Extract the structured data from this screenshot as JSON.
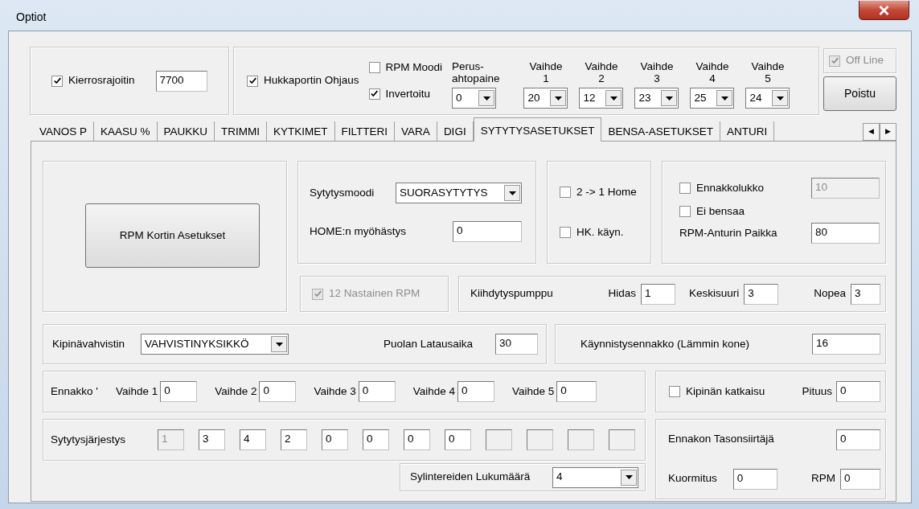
{
  "window": {
    "title": "Optiot"
  },
  "top": {
    "rev_limiter": {
      "label": "Kierrosrajoitin",
      "checked": true,
      "value": "7700"
    },
    "wastegate": {
      "label": "Hukkaportin Ohjaus",
      "checked": true
    },
    "rpm_mode": {
      "label": "RPM Moodi",
      "checked": false
    },
    "inverted": {
      "label": "Invertoitu",
      "checked": true
    },
    "combos": [
      {
        "label_lines": [
          "Perus-",
          "ahtopaine"
        ],
        "value": "0"
      },
      {
        "label_lines": [
          "Vaihde",
          "1"
        ],
        "value": "20"
      },
      {
        "label_lines": [
          "Vaihde",
          "2"
        ],
        "value": "12"
      },
      {
        "label_lines": [
          "Vaihde",
          "3"
        ],
        "value": "23"
      },
      {
        "label_lines": [
          "Vaihde",
          "4"
        ],
        "value": "25"
      },
      {
        "label_lines": [
          "Vaihde",
          "5"
        ],
        "value": "24"
      }
    ],
    "offline": {
      "label": "Off Line",
      "checked": true,
      "disabled": true
    },
    "close_button": "Poistu"
  },
  "tabs": [
    {
      "label": "VANOS P",
      "selected": false
    },
    {
      "label": "KAASU %",
      "selected": false
    },
    {
      "label": "PAUKKU",
      "selected": false
    },
    {
      "label": "TRIMMI",
      "selected": false
    },
    {
      "label": "KYTKIMET",
      "selected": false
    },
    {
      "label": "FILTTERI",
      "selected": false
    },
    {
      "label": "VARA",
      "selected": false
    },
    {
      "label": "DIGI",
      "selected": false
    },
    {
      "label": "SYTYTYSASETUKSET",
      "selected": true
    },
    {
      "label": "BENSA-ASETUKSET",
      "selected": false
    },
    {
      "label": "ANTURI",
      "selected": false
    }
  ],
  "tab_scroll": [
    "◀",
    "▶"
  ],
  "panel": {
    "rpm_card_button": "RPM Kortin Asetukset",
    "ignition_mode": {
      "mode_label": "Sytytysmoodi",
      "mode_value": "SUORASYTYTYS",
      "delay_label": "HOME:n myöhästys",
      "delay_value": "0"
    },
    "home_options": [
      {
        "label": "2 -> 1 Home",
        "checked": false
      },
      {
        "label": "HK. käyn.",
        "checked": false
      }
    ],
    "advance_lock": {
      "lock": {
        "label": "Ennakkolukko",
        "checked": false
      },
      "lock_value": "10",
      "lock_disabled": true,
      "no_fuel": {
        "label": "Ei bensaa",
        "checked": false
      },
      "sensor_label": "RPM-Anturin Paikka",
      "sensor_value": "80"
    },
    "pin12": {
      "label": "12 Nastainen RPM",
      "checked": true,
      "disabled": true
    },
    "accel_pump": {
      "label": "Kiihdytyspumppu",
      "fields": [
        {
          "label": "Hidas",
          "value": "1"
        },
        {
          "label": "Keskisuuri",
          "value": "3"
        },
        {
          "label": "Nopea",
          "value": "3"
        }
      ]
    },
    "amplifier": {
      "label": "Kipinävahvistin",
      "value": "VAHVISTINYKSIKKÖ",
      "coil_label": "Puolan Latausaika",
      "coil_value": "30"
    },
    "start_advance": {
      "label": "Käynnistysennakko (Lämmin kone)",
      "value": "16"
    },
    "gear_advance": {
      "label": "Ennakko '",
      "fields": [
        {
          "label": "Vaihde 1",
          "value": "0"
        },
        {
          "label": "Vaihde 2",
          "value": "0"
        },
        {
          "label": "Vaihde 3",
          "value": "0"
        },
        {
          "label": "Vaihde 4",
          "value": "0"
        },
        {
          "label": "Vaihde 5",
          "value": "0"
        }
      ]
    },
    "spark_cut": {
      "label": "Kipinän katkaisu",
      "checked": false,
      "length_label": "Pituus",
      "length_value": "0"
    },
    "firing_order": {
      "label": "Sytytysjärjestys",
      "fields": [
        {
          "value": "1",
          "disabled": true
        },
        {
          "value": "3",
          "disabled": false
        },
        {
          "value": "4",
          "disabled": false
        },
        {
          "value": "2",
          "disabled": false
        },
        {
          "value": "0",
          "disabled": false
        },
        {
          "value": "0",
          "disabled": false
        },
        {
          "value": "0",
          "disabled": false
        },
        {
          "value": "0",
          "disabled": false
        },
        {
          "disabled": true
        },
        {
          "disabled": true
        },
        {
          "disabled": true
        },
        {
          "disabled": true
        }
      ]
    },
    "cylinders": {
      "label": "Sylintereiden Lukumäärä",
      "value": "4"
    },
    "advance_shifter": {
      "label": "Ennakon Tasonsiirtäjä",
      "value": "0",
      "load_label": "Kuormitus",
      "load_value": "0",
      "rpm_label": "RPM",
      "rpm_value": "0"
    }
  }
}
